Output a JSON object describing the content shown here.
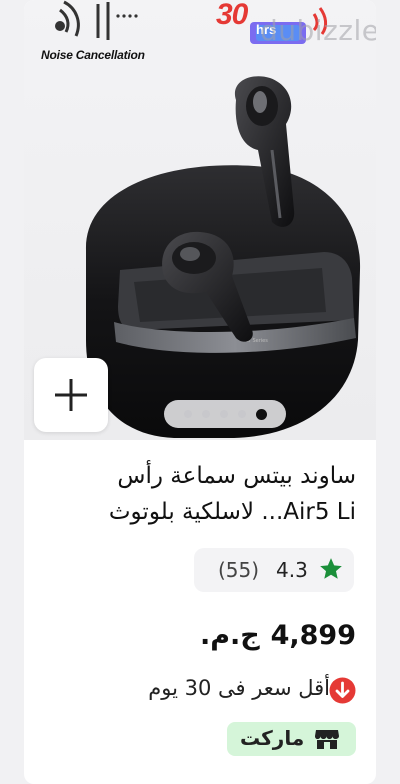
{
  "listing": {
    "noise_badge_text": "Noise Cancellation",
    "hours_badge_number": "30",
    "hours_badge_unit": "hrs",
    "watermark": "dubizzle",
    "carousel": {
      "total": 5,
      "active_index": 4
    },
    "title_line1": "ساوند بيتس سماعة رأس",
    "title_line2": "Air5 Li... لاسلكية بلوتوث",
    "rating_value": "4.3",
    "rating_count": "(55)",
    "price_amount": "4,899",
    "price_currency": "ج.م.",
    "lowest_price_note": "أقل سعر فى 30 يوم",
    "store_badge": "ماركت"
  },
  "colors": {
    "accent_red": "#e53935",
    "star_green": "#1b8f3a",
    "badge_green_bg": "#d5f5d9",
    "text_dark": "#111111"
  },
  "icons": [
    "plus-icon",
    "star-icon",
    "arrow-down-icon",
    "store-icon",
    "wifi-waves-icon"
  ]
}
